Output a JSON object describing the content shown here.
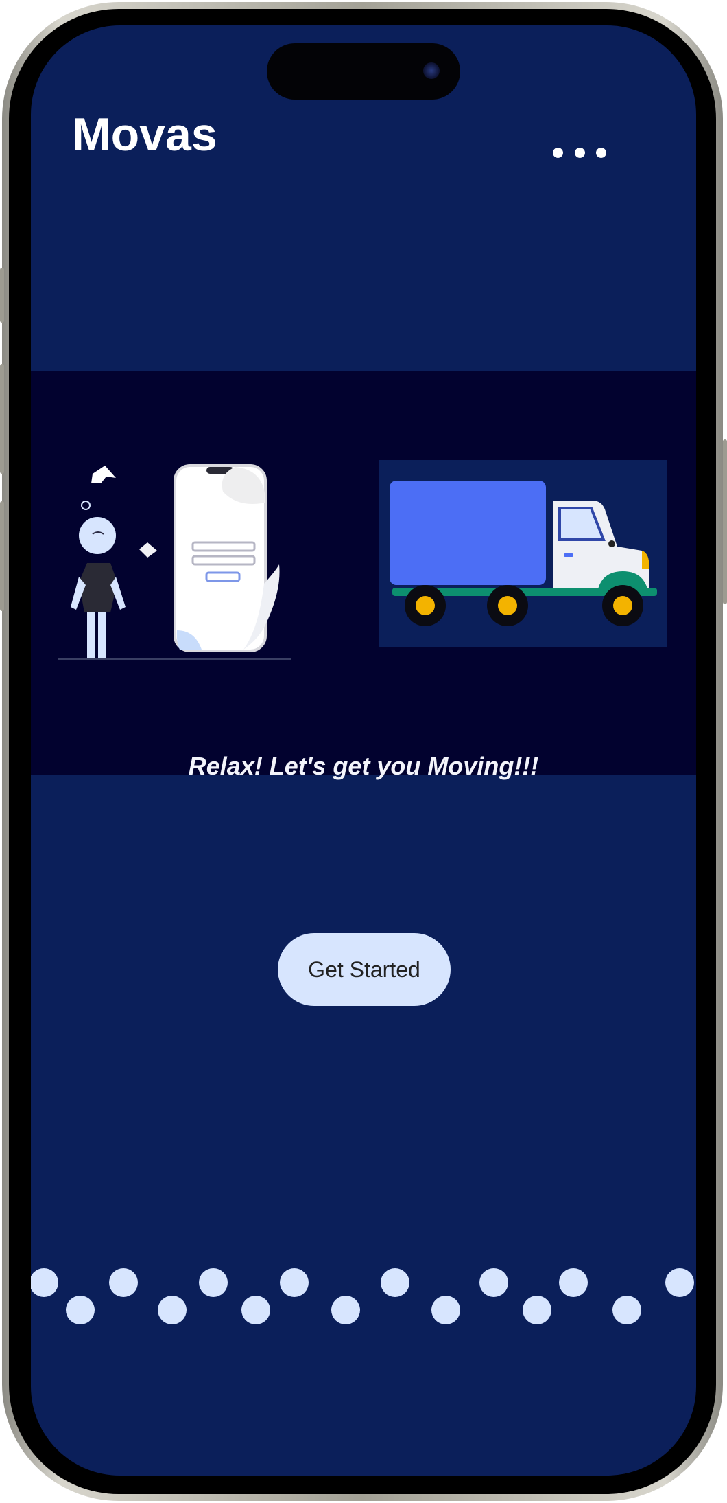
{
  "app": {
    "title": "Movas"
  },
  "header": {
    "menu_icon": "more-horizontal-icon"
  },
  "hero": {
    "tagline": "Relax! Let's get you Moving!!!",
    "illustrations": [
      "person-with-phone-illustration",
      "delivery-truck-illustration"
    ]
  },
  "cta": {
    "label": "Get Started"
  },
  "decoration": {
    "pattern": "dots-pattern"
  },
  "colors": {
    "background": "#0b1f5a",
    "hero_background": "#02022f",
    "button": "#d7e5fe",
    "truck_cargo": "#4c6ef5",
    "truck_wheel": "#f3b300",
    "truck_base": "#0d8f6f",
    "text_light": "#ffffff"
  }
}
